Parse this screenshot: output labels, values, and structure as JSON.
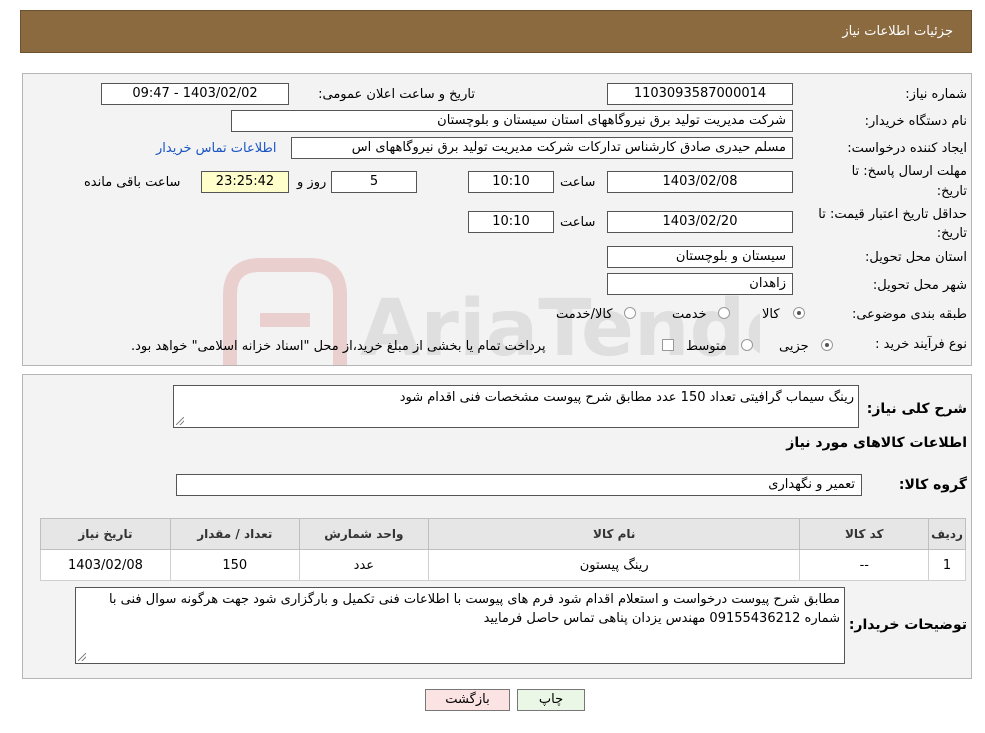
{
  "header": {
    "title": "جزئیات اطلاعات نیاز"
  },
  "form": {
    "need_number_label": "شماره نیاز:",
    "need_number": "1103093587000014",
    "announce_label": "تاریخ و ساعت اعلان عمومی:",
    "announce_value": "1403/02/02 - 09:47",
    "buyer_label": "نام دستگاه خریدار:",
    "buyer_value": "شرکت مدیریت تولید برق نیروگاههای استان سیستان و بلوچستان",
    "creator_label": "ایجاد کننده درخواست:",
    "creator_value": "مسلم حیدری صادق کارشناس تدارکات شرکت مدیریت تولید برق نیروگاههای اس",
    "contact_link": "اطلاعات تماس خریدار",
    "deadline_label_1": "مهلت ارسال پاسخ: تا",
    "deadline_label_2": "تاریخ:",
    "deadline_date": "1403/02/08",
    "time_label": "ساعت",
    "deadline_time": "10:10",
    "days_value": "5",
    "days_label": "روز و",
    "remaining_time": "23:25:42",
    "remaining_label": "ساعت باقی مانده",
    "validity_label_1": "حداقل تاریخ اعتبار قیمت: تا",
    "validity_label_2": "تاریخ:",
    "validity_date": "1403/02/20",
    "validity_time": "10:10",
    "province_label": "استان محل تحویل:",
    "province_value": "سیستان و بلوچستان",
    "city_label": "شهر محل تحویل:",
    "city_value": "زاهدان",
    "category_label": "طبقه بندی موضوعی:",
    "category_options": [
      "کالا",
      "خدمت",
      "کالا/خدمت"
    ],
    "process_label": "نوع فرآیند خرید :",
    "process_options": [
      "جزیی",
      "متوسط"
    ],
    "process_note": "پرداخت تمام یا بخشی از مبلغ خرید،از محل \"اسناد خزانه اسلامی\" خواهد بود."
  },
  "details": {
    "summary_label": "شرح کلی نیاز:",
    "summary_value": "رینگ سیماب گرافیتی   تعداد  150 عدد     مطابق شرح پیوست مشخصات فنی اقدام شود",
    "goods_info_title": "اطلاعات کالاهای مورد نیاز",
    "goods_group_label": "گروه کالا:",
    "goods_group_value": "تعمیر و نگهداری",
    "table": {
      "headers": [
        "ردیف",
        "کد کالا",
        "نام کالا",
        "واحد شمارش",
        "تعداد / مقدار",
        "تاریخ نیاز"
      ],
      "rows": [
        [
          "1",
          "--",
          "رینگ پیستون",
          "عدد",
          "150",
          "1403/02/08"
        ]
      ]
    },
    "buyer_notes_label": "توضیحات خریدار:",
    "buyer_notes_value": "مطابق شرح پیوست درخواست و استعلام اقدام شود فرم های پیوست با اطلاعات فنی تکمیل و بارگزاری شود  جهت هرگونه سوال فنی با شماره 09155436212 مهندس یزدان پناهی تماس حاصل فرمایید"
  },
  "buttons": {
    "print": "چاپ",
    "back": "بازگشت"
  },
  "watermark": {
    "text": "AriaTender.neT"
  }
}
